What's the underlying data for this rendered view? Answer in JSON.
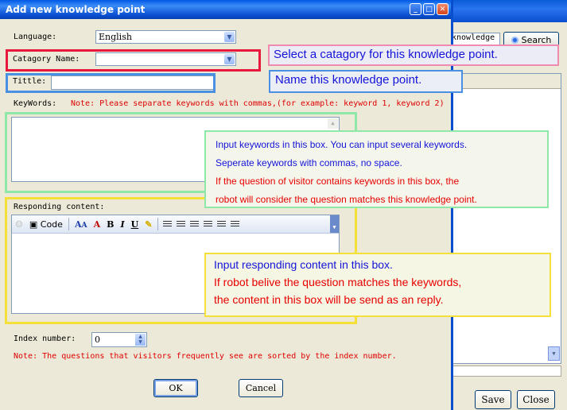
{
  "background_window": {
    "search_input_value": "knowledge",
    "search_button_label": "Search",
    "save_label": "Save",
    "close_label": "Close"
  },
  "dialog": {
    "title": "Add new knowledge point",
    "language_label": "Language:",
    "language_value": "English",
    "category_label": "Catagory Name:",
    "category_value": "",
    "title_label": "Tittle:",
    "title_value": "",
    "keywords_label": "KeyWords:",
    "keywords_note": "Note: Please separate keywords with commas,(for example: keyword 1, keyword 2)",
    "responding_label": "Responding content:",
    "toolbar_code": "Code",
    "index_label": "Index number:",
    "index_value": "0",
    "index_note": "Note: The questions that visitors frequently see are sorted  by the index number.",
    "ok_label": "OK",
    "cancel_label": "Cancel"
  },
  "annotations": {
    "category": "Select a catagory for this knowledge point.",
    "title": "Name this knowledge point.",
    "keywords": [
      "Input keywords in this box. You can input several keywords.",
      "Seperate keywords with commas, no space.",
      "If the question of visitor contains keywords in this box, the",
      "robot will consider the question matches this knowledge point."
    ],
    "responding": [
      "Input responding content in this box.",
      "If robot belive the question matches the keywords,",
      "the content in this box will be send as an reply."
    ]
  },
  "colors": {
    "red": "#e8183c",
    "blue": "#4a90e2",
    "green": "#8fe8a8",
    "yellow": "#f5e03a"
  }
}
